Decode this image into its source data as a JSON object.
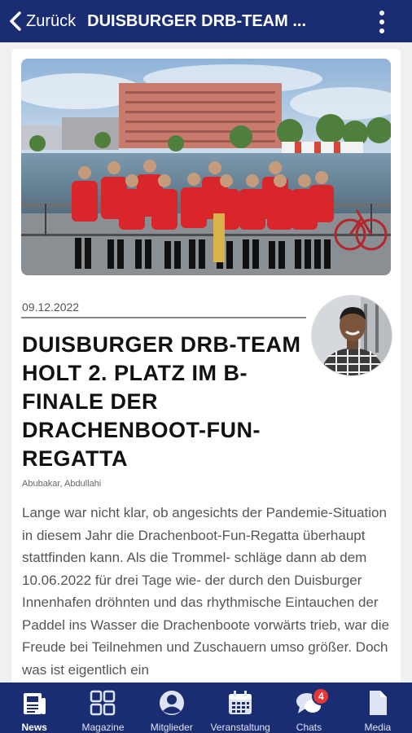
{
  "header": {
    "back_label": "Zurück",
    "title": "DUISBURGER DRB-TEAM ..."
  },
  "article": {
    "date": "09.12.2022",
    "headline": "DUISBURGER DRB-TEAM HOLT 2. PLATZ IM B-FINALE DER DRACHENBOOT-FUN-REGATTA",
    "author": "Abubakar, Abdullahi",
    "body": "Lange war nicht klar, ob angesichts der Pandemie-Situation in diesem Jahr die Drachenboot-Fun-Regatta überhaupt stattfinden kann. Als die Trommel- schläge dann ab dem 10.06.2022 für drei Tage wie- der durch den Duisburger Innenhafen dröhnten und das rhythmische Eintauchen der Paddel ins Wasser die Drachenboote vorwärts trieb, war die Freude bei Teilnehmen und Zuschauern umso größer. Doch was ist eigentlich ein"
  },
  "tabs": [
    {
      "label": "News",
      "icon": "news-icon",
      "active": true
    },
    {
      "label": "Magazine",
      "icon": "grid-icon"
    },
    {
      "label": "Mitglieder",
      "icon": "person-icon"
    },
    {
      "label": "Veranstaltung",
      "icon": "calendar-icon"
    },
    {
      "label": "Chats",
      "icon": "chat-icon",
      "badge": "4"
    },
    {
      "label": "Media",
      "icon": "file-icon"
    }
  ],
  "colors": {
    "brand": "#1b2d72",
    "badge": "#e53935"
  }
}
